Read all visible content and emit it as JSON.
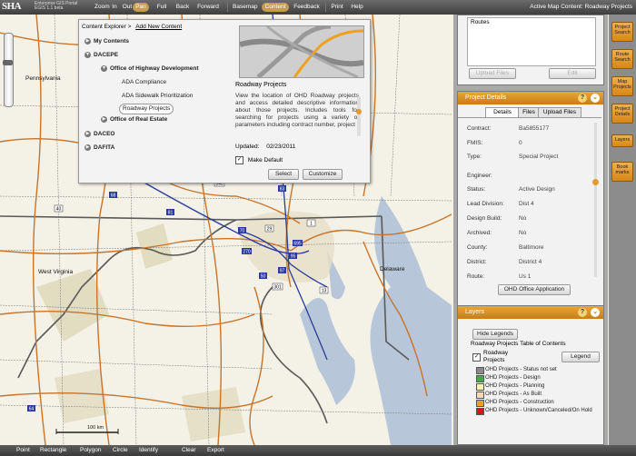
{
  "app": {
    "logo": "SHA",
    "subtitle_line1": "Enterprise GIS Portal",
    "subtitle_line2": "EGIS 1.1 beta"
  },
  "toolbar": {
    "items": [
      "Zoom",
      "In",
      "Out",
      "Pan",
      "Full",
      "Back",
      "Forward",
      "Basemap",
      "Content",
      "Feedback",
      "Print",
      "Help"
    ],
    "active": [
      "Pan",
      "Content"
    ],
    "active_map_label": "Active Map Content:",
    "active_map_value": "Roadway Projects"
  },
  "map": {
    "state_labels": [
      "Pennsylvania",
      "West Virginia",
      "Delaware"
    ],
    "scale_label": "100 km",
    "shield_labels": [
      "70",
      "270",
      "95",
      "695",
      "97",
      "50",
      "301",
      "13",
      "81",
      "68",
      "83",
      "64",
      "15",
      "29",
      "1",
      "340",
      "40",
      "11"
    ]
  },
  "bottombar": {
    "items": [
      "Point",
      "Rectangle",
      "Polygon",
      "Circle",
      "Identify",
      "Clear",
      "Export"
    ]
  },
  "explorer": {
    "breadcrumb": "Content Explorer >",
    "add_new": "Add New Content",
    "tree": {
      "my_contents": "My Contents",
      "dacepe": "DACEPE",
      "ohd": "Office of Highway Development",
      "ada_compliance": "ADA Compliance",
      "ada_sidewalk": "ADA Sidewalk Prioritization",
      "roadway_projects": "Roadway Projects",
      "real_estate": "Office of Real Estate",
      "daceo": "DACEO",
      "dafita": "DAFITA"
    },
    "preview_title": "Roadway Projects",
    "description": "View the location of OHD Roadway projects and access detailed descriptive information about those projects. Includes tools for searching for projects using a variety of parameters including contract number, project",
    "updated_label": "Updated:",
    "updated_value": "02/23/2011",
    "make_default": "Make Default",
    "select_btn": "Select",
    "customize_btn": "Customize"
  },
  "routes_panel": {
    "list_header": "Routes",
    "upload_btn": "Upload Files",
    "edit_btn": "Edit"
  },
  "project_details": {
    "title": "Project Details",
    "tabs": [
      "Details",
      "Files",
      "Upload Files"
    ],
    "fields": [
      {
        "key": "Contract:",
        "value": "Ba5855177"
      },
      {
        "key": "FMIS:",
        "value": "0"
      },
      {
        "key": "Type:",
        "value": "Special Project"
      },
      {
        "key": "Engineer:",
        "value": ""
      },
      {
        "key": "Status:",
        "value": "Active Design"
      },
      {
        "key": "Lead Division:",
        "value": "Dist 4"
      },
      {
        "key": "Design Build:",
        "value": "No"
      },
      {
        "key": "Archived:",
        "value": "No"
      },
      {
        "key": "County:",
        "value": "Baltimore"
      },
      {
        "key": "District:",
        "value": "District 4"
      },
      {
        "key": "Route:",
        "value": "Us 1"
      }
    ],
    "office_app_btn": "OHD Office Application"
  },
  "layers": {
    "title": "Layers",
    "hide_legends_btn": "Hide Legends",
    "toc_title": "Roadway Projects Table of Contents",
    "layer_name_line1": "Roadway",
    "layer_name_line2": "Projects",
    "legend_btn": "Legend",
    "legend": [
      {
        "label": "OHD Projects - Status not set",
        "color": "#8a8a8a"
      },
      {
        "label": "OHD Projects - Design",
        "color": "#3fae3f"
      },
      {
        "label": "OHD Projects - Planning",
        "color": "#f5f5b0"
      },
      {
        "label": "OHD Projects - As Built",
        "color": "#f7d9b8"
      },
      {
        "label": "OHD Projects - Construction",
        "color": "#f0a020"
      },
      {
        "label": "OHD Projects - Unknown/Canceled/On Hold",
        "color": "#d01818"
      }
    ]
  },
  "side_tabs": [
    "Project Search",
    "Route Search",
    "Map Projects",
    "Project Details",
    "Layers",
    "Book marks"
  ],
  "colors": {
    "accent": "#e39a2e",
    "water": "#b7c6d9",
    "roads": "#c8742a",
    "interstate": "#2a3a9a"
  }
}
